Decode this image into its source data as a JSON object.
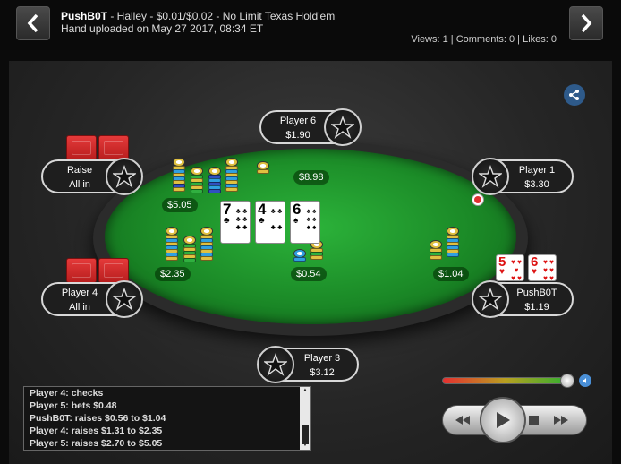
{
  "header": {
    "hero_name": "PushB0T",
    "title_rest": " - Halley - $0.01/$0.02 - No Limit Texas Hold'em",
    "uploaded": "Hand uploaded on May 27 2017, 08:34 ET",
    "stats": "Views: 1 | Comments: 0 | Likes: 0"
  },
  "seats": {
    "player6": {
      "name": "Player 6",
      "stack": "$1.90"
    },
    "player1": {
      "name": "Player 1",
      "stack": "$3.30"
    },
    "raise": {
      "name": "Raise",
      "stack": "All in"
    },
    "player4": {
      "name": "Player 4",
      "stack": "All in"
    },
    "hero": {
      "name": "PushB0T",
      "stack": "$1.19"
    },
    "player3": {
      "name": "Player 3",
      "stack": "$3.12"
    }
  },
  "bets": {
    "top_center": "$8.98",
    "top_left": "$5.05",
    "left": "$2.35",
    "pot": "$0.54",
    "right": "$1.04"
  },
  "board": [
    {
      "rank": "7",
      "suit": "♣",
      "color": "#000000"
    },
    {
      "rank": "4",
      "suit": "♣",
      "color": "#000000"
    },
    {
      "rank": "6",
      "suit": "♠",
      "color": "#000000"
    }
  ],
  "hero_cards": [
    {
      "rank": "5",
      "suit": "♥",
      "color": "#d11111"
    },
    {
      "rank": "6",
      "suit": "♥",
      "color": "#d11111"
    }
  ],
  "log": [
    "Player 4: checks",
    "Player 5: bets $0.48",
    "PushB0T: raises $0.56 to $1.04",
    "Player 4: raises $1.31 to $2.35",
    "Player 5: raises $2.70 to $5.05"
  ],
  "icons": {
    "prev": "chevron-left-icon",
    "next": "chevron-right-icon",
    "share": "share-icon",
    "volume": "volume-icon",
    "rewind": "rewind-icon",
    "play": "play-icon",
    "stop": "stop-icon",
    "fast_forward": "fast-forward-icon"
  },
  "colors": {
    "felt": "#1b8a27",
    "card_back": "#d12a2a",
    "share": "#2e5a8a"
  }
}
